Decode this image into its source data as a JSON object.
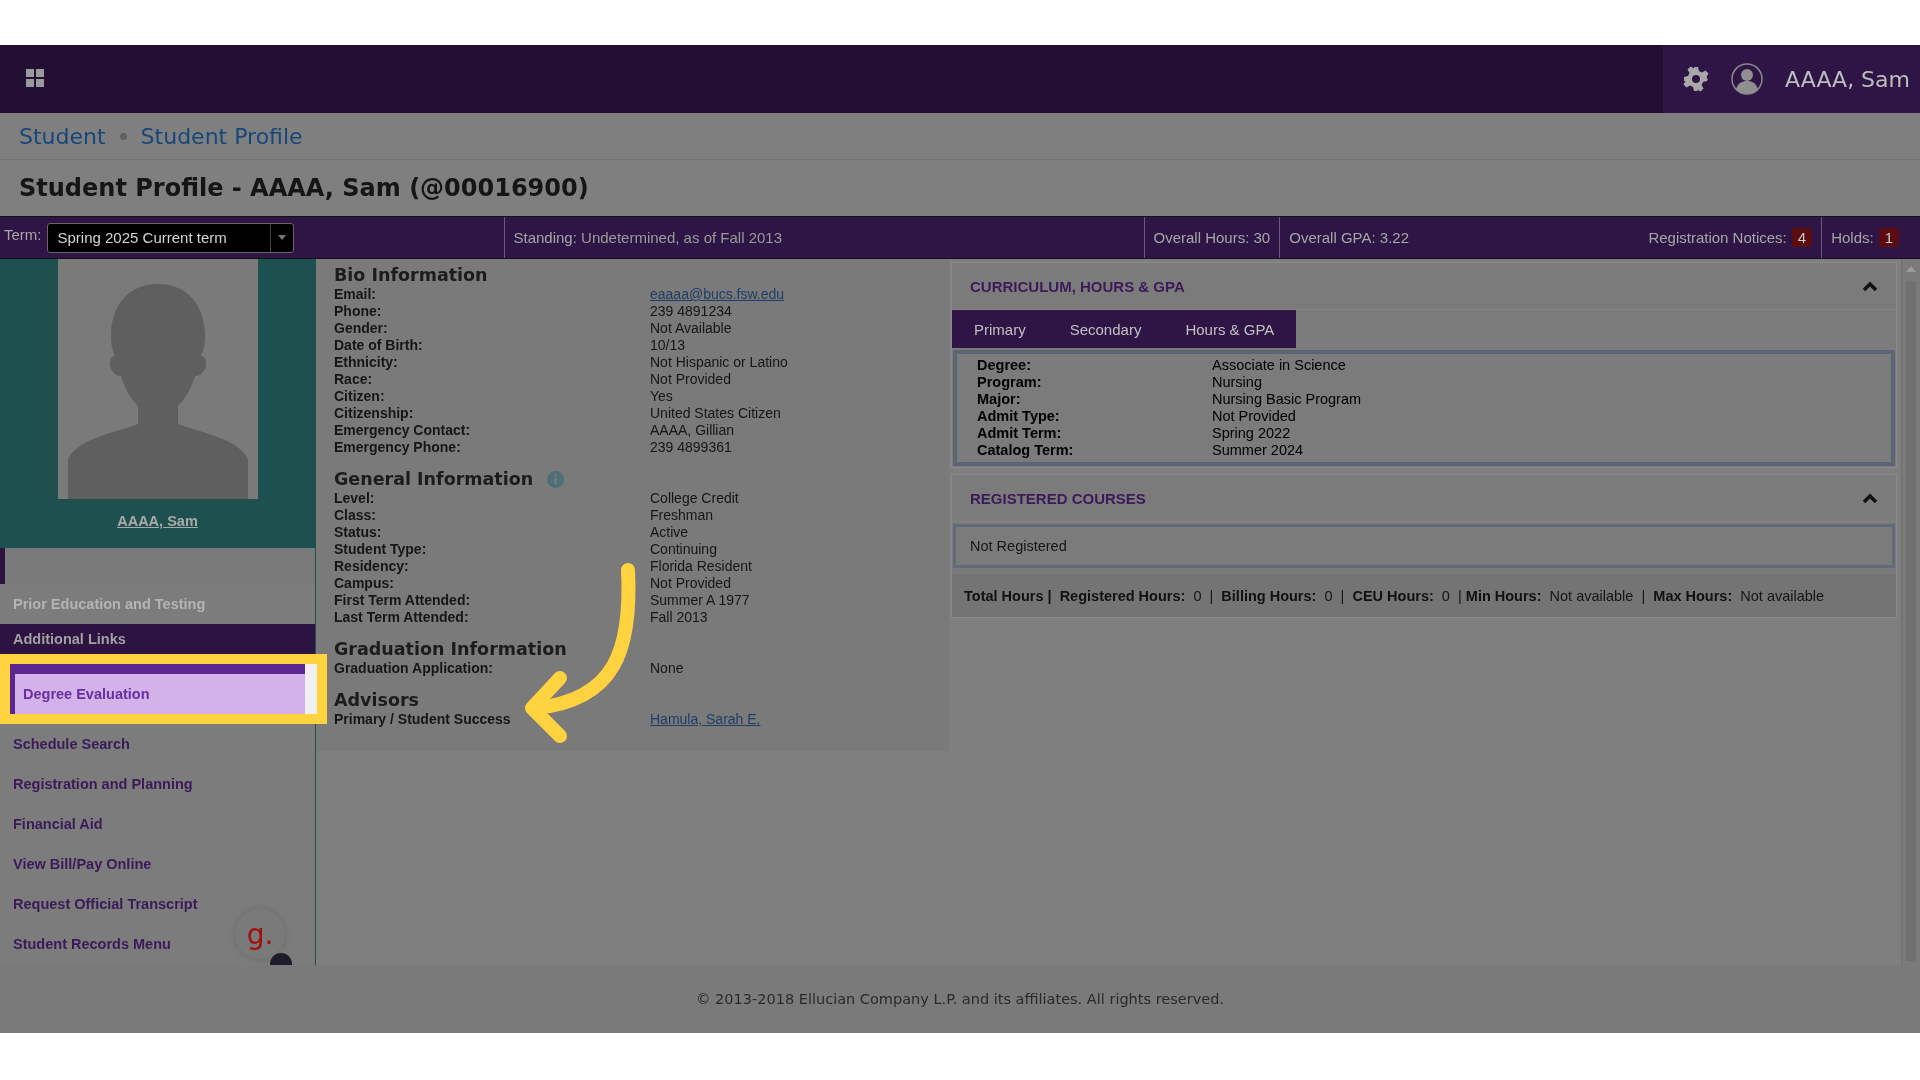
{
  "topbar": {
    "user_name": "AAAA, Sam"
  },
  "breadcrumb": [
    "Student",
    "Student Profile"
  ],
  "page_title": "Student Profile - AAAA, Sam (@00016900)",
  "term_bar": {
    "term_label": "Term:",
    "term_value": "Spring 2025 Current term",
    "standing_label": "Standing:",
    "standing_value": "Undetermined, as of Fall 2013",
    "hours_label": "Overall Hours:",
    "hours_value": "30",
    "gpa_label": "Overall GPA:",
    "gpa_value": "3.22",
    "notices_label": "Registration Notices:",
    "notices_count": "4",
    "holds_label": "Holds:",
    "holds_count": "1"
  },
  "sidebar": {
    "student_name": "AAAA, Sam",
    "prior_items": [
      {
        "label": "Prior Education and Testing",
        "disabled": true
      }
    ],
    "links_title": "Additional Links",
    "links": [
      {
        "label": "Degree Evaluation",
        "selected": true
      },
      {
        "label": "Schedule Search",
        "selected": false
      },
      {
        "label": "Registration and Planning",
        "selected": false
      },
      {
        "label": "Financial Aid",
        "selected": false
      },
      {
        "label": "View Bill/Pay Online",
        "selected": false
      },
      {
        "label": "Request Official Transcript",
        "selected": false
      },
      {
        "label": "Student Records Menu",
        "selected": false
      }
    ]
  },
  "help_badge": "g.",
  "bio_sections": [
    {
      "title": "Bio Information",
      "info": false,
      "rows": [
        {
          "label": "Email:",
          "value": "eaaaa@bucs.fsw.edu",
          "kind": "link"
        },
        {
          "label": "Phone:",
          "value": "239 4891234",
          "kind": "text"
        },
        {
          "label": "Gender:",
          "value": "Not Available",
          "kind": "text"
        },
        {
          "label": "Date of Birth:",
          "value": "10/13",
          "kind": "text"
        },
        {
          "label": "Ethnicity:",
          "value": "Not Hispanic or Latino",
          "kind": "text"
        },
        {
          "label": "Race:",
          "value": "Not Provided",
          "kind": "text"
        },
        {
          "label": "Citizen:",
          "value": "Yes",
          "kind": "text"
        },
        {
          "label": "Citizenship:",
          "value": "United States Citizen",
          "kind": "text"
        },
        {
          "label": "Emergency Contact:",
          "value": "AAAA, Gillian",
          "kind": "text"
        },
        {
          "label": "Emergency Phone:",
          "value": "239 4899361",
          "kind": "text"
        }
      ]
    },
    {
      "title": "General Information",
      "info": true,
      "rows": [
        {
          "label": "Level:",
          "value": "College Credit",
          "kind": "text"
        },
        {
          "label": "Class:",
          "value": "Freshman",
          "kind": "text"
        },
        {
          "label": "Status:",
          "value": "Active",
          "kind": "text"
        },
        {
          "label": "Student Type:",
          "value": "Continuing",
          "kind": "text"
        },
        {
          "label": "Residency:",
          "value": "Florida Resident",
          "kind": "text"
        },
        {
          "label": "Campus:",
          "value": "Not Provided",
          "kind": "text"
        },
        {
          "label": "First Term Attended:",
          "value": "Summer A 1977",
          "kind": "text"
        },
        {
          "label": "Last Term Attended:",
          "value": "Fall 2013",
          "kind": "text"
        }
      ]
    },
    {
      "title": "Graduation Information",
      "info": false,
      "rows": [
        {
          "label": "Graduation Application:",
          "value": "None",
          "kind": "text"
        }
      ]
    },
    {
      "title": "Advisors",
      "info": false,
      "rows": [
        {
          "label": "Primary / Student Success",
          "value": "Hamula, Sarah E.",
          "kind": "link"
        }
      ]
    }
  ],
  "curriculum": {
    "title": "CURRICULUM, HOURS & GPA",
    "tabs": [
      "Primary",
      "Secondary",
      "Hours & GPA"
    ],
    "rows": [
      {
        "label": "Degree:",
        "value": "Associate in Science"
      },
      {
        "label": "Program:",
        "value": "Nursing"
      },
      {
        "label": "Major:",
        "value": "Nursing Basic Program"
      },
      {
        "label": "Admit Type:",
        "value": "Not Provided"
      },
      {
        "label": "Admit Term:",
        "value": "Spring 2022"
      },
      {
        "label": "Catalog Term:",
        "value": "Summer 2024"
      }
    ]
  },
  "registered_courses": {
    "title": "REGISTERED COURSES",
    "message": "Not Registered",
    "summary": "**Total Hours |**  **Registered Hours:**  0  |  **Billing Hours:**  0  |  **CEU Hours:**  0  | **Min Hours:**  Not available  |  **Max Hours:**  Not available"
  },
  "footer": "© 2013-2018 Ellucian Company L.P. and its affiliates. All rights reserved."
}
